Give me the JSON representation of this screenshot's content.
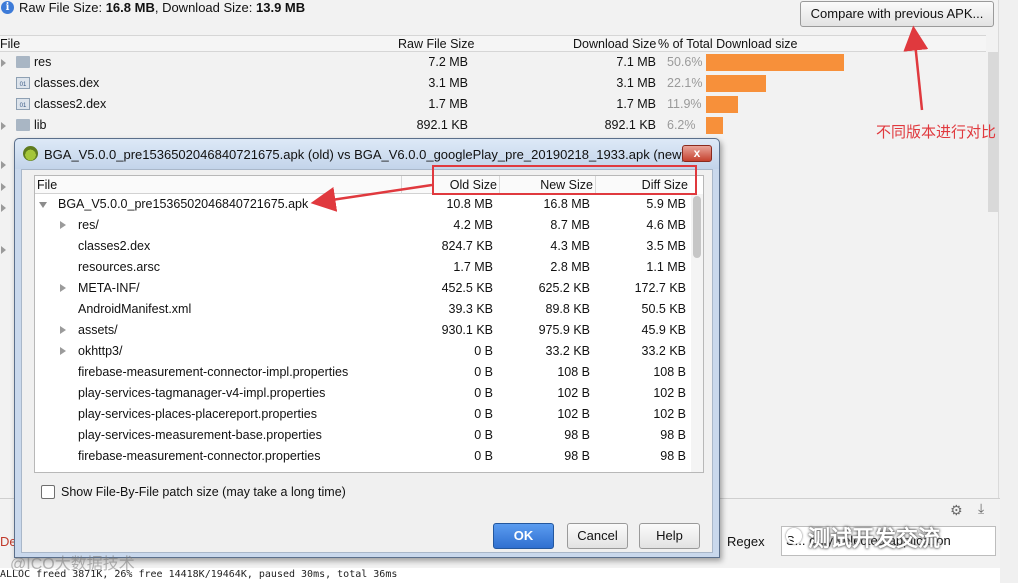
{
  "header": {
    "raw_label": "Raw File Size: ",
    "raw_value": "16.8 MB",
    "dl_label": ", Download Size: ",
    "dl_value": "13.9 MB",
    "compare_button": "Compare with previous APK..."
  },
  "bg_table": {
    "columns": [
      "File",
      "Raw File Size",
      "Download Size",
      "% of Total Download size"
    ],
    "rows": [
      {
        "name": "res",
        "icon": "folder-icon",
        "expandable": true,
        "raw": "7.2 MB",
        "download": "7.1 MB",
        "pct": "50.6%",
        "pct_value": 50.6
      },
      {
        "name": "classes.dex",
        "icon": "dex-file-icon",
        "expandable": false,
        "raw": "3.1 MB",
        "download": "3.1 MB",
        "pct": "22.1%",
        "pct_value": 22.1
      },
      {
        "name": "classes2.dex",
        "icon": "dex-file-icon",
        "expandable": false,
        "raw": "1.7 MB",
        "download": "1.7 MB",
        "pct": "11.9%",
        "pct_value": 11.9
      },
      {
        "name": "lib",
        "icon": "folder-icon",
        "expandable": true,
        "raw": "892.1 KB",
        "download": "892.1 KB",
        "pct": "6.2%",
        "pct_value": 6.2
      }
    ]
  },
  "annotation": "不同版本进行对比",
  "dialog": {
    "title": "BGA_V5.0.0_pre1536502046840721675.apk (old) vs BGA_V6.0.0_googlePlay_pre_20190218_1933.apk (new)",
    "close_label": "x",
    "columns": [
      "File",
      "Old Size",
      "New Size",
      "Diff Size"
    ],
    "rows": [
      {
        "name": "BGA_V5.0.0_pre1536502046840721675.apk",
        "level": 0,
        "toggle": "open",
        "old": "10.8 MB",
        "new": "16.8 MB",
        "diff": "5.9 MB"
      },
      {
        "name": "res/",
        "level": 1,
        "toggle": "closed",
        "old": "4.2 MB",
        "new": "8.7 MB",
        "diff": "4.6 MB"
      },
      {
        "name": "classes2.dex",
        "level": 1,
        "toggle": "none",
        "old": "824.7 KB",
        "new": "4.3 MB",
        "diff": "3.5 MB"
      },
      {
        "name": "resources.arsc",
        "level": 1,
        "toggle": "none",
        "old": "1.7 MB",
        "new": "2.8 MB",
        "diff": "1.1 MB"
      },
      {
        "name": "META-INF/",
        "level": 1,
        "toggle": "closed",
        "old": "452.5 KB",
        "new": "625.2 KB",
        "diff": "172.7 KB"
      },
      {
        "name": "AndroidManifest.xml",
        "level": 1,
        "toggle": "none",
        "old": "39.3 KB",
        "new": "89.8 KB",
        "diff": "50.5 KB"
      },
      {
        "name": "assets/",
        "level": 1,
        "toggle": "closed",
        "old": "930.1 KB",
        "new": "975.9 KB",
        "diff": "45.9 KB"
      },
      {
        "name": "okhttp3/",
        "level": 1,
        "toggle": "closed",
        "old": "0 B",
        "new": "33.2 KB",
        "diff": "33.2 KB"
      },
      {
        "name": "firebase-measurement-connector-impl.properties",
        "level": 1,
        "toggle": "none",
        "old": "0 B",
        "new": "108 B",
        "diff": "108 B"
      },
      {
        "name": "play-services-tagmanager-v4-impl.properties",
        "level": 1,
        "toggle": "none",
        "old": "0 B",
        "new": "102 B",
        "diff": "102 B"
      },
      {
        "name": "play-services-places-placereport.properties",
        "level": 1,
        "toggle": "none",
        "old": "0 B",
        "new": "102 B",
        "diff": "102 B"
      },
      {
        "name": "play-services-measurement-base.properties",
        "level": 1,
        "toggle": "none",
        "old": "0 B",
        "new": "98 B",
        "diff": "98 B"
      },
      {
        "name": "firebase-measurement-connector.properties",
        "level": 1,
        "toggle": "none",
        "old": "0 B",
        "new": "98 B",
        "diff": "98 B"
      }
    ],
    "checkbox_label": "Show File-By-File patch size (may take a long time)",
    "checkbox_checked": false,
    "ok": "OK",
    "cancel": "Cancel",
    "help": "Help"
  },
  "bottom": {
    "regex_label": "Regex",
    "filter_value": "S... only selected application",
    "de_text": "De",
    "log": "ALLOC freed 3871K, 26% free 14418K/19464K, paused 30ms, total 36ms"
  },
  "watermarks": {
    "left": "@ICO大数据技术",
    "right": "测试开发交流"
  },
  "colors": {
    "bar": "#f7903a",
    "annotation": "#e0393e",
    "ok_button": "#2f6fd0"
  }
}
